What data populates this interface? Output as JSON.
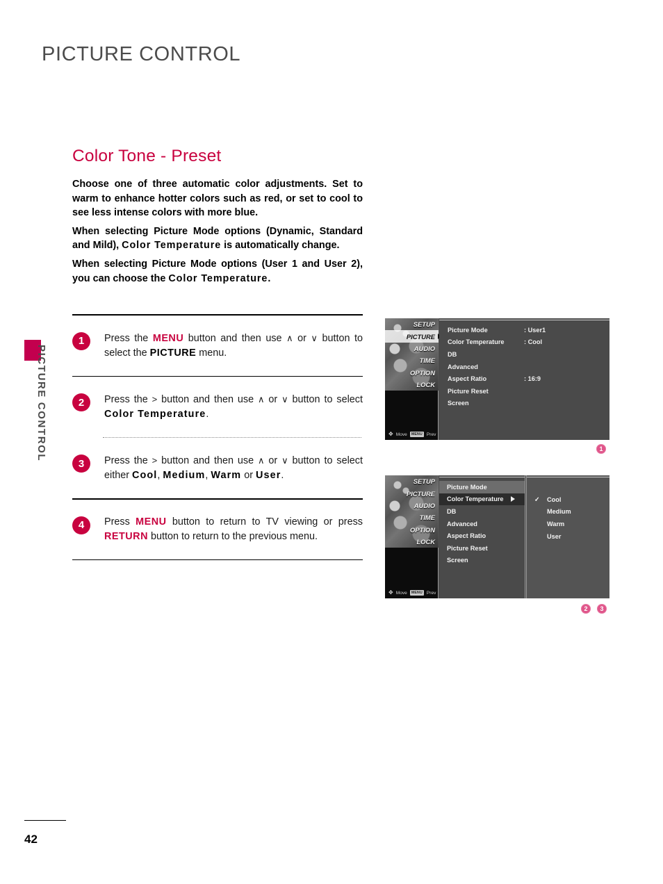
{
  "header": {
    "title": "PICTURE CONTROL"
  },
  "side_tab": {
    "label": "PICTURE CONTROL"
  },
  "section": {
    "title": "Color Tone - Preset"
  },
  "intro": {
    "p1": "Choose one of three automatic color adjustments. Set to warm to enhance hotter colors such as red, or set to cool to see less intense colors with more blue.",
    "p2_a": "When selecting Picture Mode options (Dynamic, Standard and Mild), ",
    "p2_b": "Color Temperature",
    "p2_c": " is automatically change.",
    "p3_a": "When selecting Picture Mode options (User 1 and User 2), you can choose the ",
    "p3_b": "Color Temperature",
    "p3_c": "."
  },
  "steps": [
    {
      "num": "1",
      "t1": "Press the ",
      "kw1": "MENU",
      "t2": " button and then use ",
      "up": "∧",
      "t3": " or  ",
      "down": "∨",
      "t4": " button to select the ",
      "kw2": "PICTURE",
      "t5": " menu."
    },
    {
      "num": "2",
      "t1": "Press the ",
      "kw1": ">",
      "t2": " button and then use ",
      "up": "∧",
      "t3": " or  ",
      "down": "∨",
      "t4": " button to select ",
      "kw2": "Color Temperature",
      "t5": "."
    },
    {
      "num": "3",
      "t1": "Press the ",
      "kw1": ">",
      "t2": " button and then use ",
      "up": "∧",
      "t3": " or  ",
      "down": "∨",
      "t4": " button to select either ",
      "opt1": "Cool",
      "sep1": ", ",
      "opt2": "Medium",
      "sep2": ", ",
      "opt3": "Warm",
      "sep3": " or ",
      "opt4": "User",
      "t5": "."
    },
    {
      "num": "4",
      "t1": "Press ",
      "kw1": "MENU",
      "t2": " button to return to TV viewing or press ",
      "kw2": "RETURN",
      "t3": " button to return to the previous menu."
    }
  ],
  "osd1": {
    "sidebar": [
      {
        "label": "SETUP",
        "selected": false
      },
      {
        "label": "PICTURE",
        "selected": true
      },
      {
        "label": "AUDIO",
        "selected": false
      },
      {
        "label": "TIME",
        "selected": false
      },
      {
        "label": "OPTION",
        "selected": false
      },
      {
        "label": "LOCK",
        "selected": false
      }
    ],
    "footer": {
      "move": "Move",
      "menu_chip": "MENU",
      "prev": "Prev"
    },
    "rows": [
      {
        "label": "Picture Mode",
        "value": ": User1"
      },
      {
        "label": "Color Temperature",
        "value": ": Cool"
      },
      {
        "label": "DB",
        "value": ""
      },
      {
        "label": "Advanced",
        "value": ""
      },
      {
        "label": "Aspect Ratio",
        "value": ": 16:9"
      },
      {
        "label": "Picture Reset",
        "value": ""
      },
      {
        "label": "Screen",
        "value": ""
      }
    ]
  },
  "osd2": {
    "sidebar": [
      {
        "label": "SETUP"
      },
      {
        "label": "PICTURE"
      },
      {
        "label": "AUDIO"
      },
      {
        "label": "TIME"
      },
      {
        "label": "OPTION"
      },
      {
        "label": "LOCK"
      }
    ],
    "footer": {
      "move": "Move",
      "menu_chip": "MENU",
      "prev": "Prev"
    },
    "rows": [
      {
        "label": "Picture Mode",
        "state": "light"
      },
      {
        "label": "Color Temperature",
        "state": "hl",
        "arrow": true
      },
      {
        "label": "DB",
        "state": ""
      },
      {
        "label": "Advanced",
        "state": ""
      },
      {
        "label": "Aspect Ratio",
        "state": ""
      },
      {
        "label": "Picture Reset",
        "state": ""
      },
      {
        "label": "Screen",
        "state": ""
      }
    ],
    "options": [
      {
        "label": "Cool",
        "checked": true
      },
      {
        "label": "Medium",
        "checked": false
      },
      {
        "label": "Warm",
        "checked": false
      },
      {
        "label": "User",
        "checked": false
      }
    ],
    "check_glyph": "✓"
  },
  "callouts": {
    "c1": "1",
    "c2": "2",
    "c3": "3"
  },
  "footer": {
    "page_number": "42"
  },
  "colors": {
    "accent": "#c8023f",
    "badge": "#e0558a",
    "header_gray": "#4b4b4b",
    "osd_bg": "#4a4a4a"
  }
}
